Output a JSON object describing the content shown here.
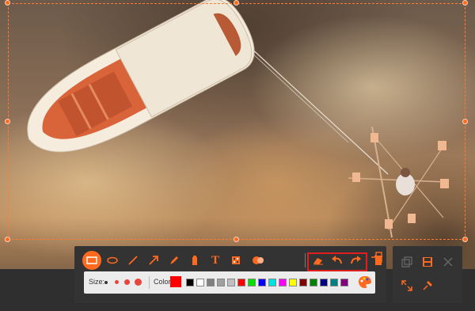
{
  "toolbar": {
    "tools": [
      {
        "name": "rectangle-tool",
        "icon": "rectangle-icon",
        "active": true
      },
      {
        "name": "ellipse-tool",
        "icon": "ellipse-icon",
        "active": false
      },
      {
        "name": "line-tool",
        "icon": "line-icon",
        "active": false
      },
      {
        "name": "arrow-tool",
        "icon": "arrow-icon",
        "active": false
      },
      {
        "name": "pen-tool",
        "icon": "pen-icon",
        "active": false
      },
      {
        "name": "highlighter-tool",
        "icon": "highlighter-icon",
        "active": false
      },
      {
        "name": "text-tool",
        "icon": "text-icon",
        "active": false
      },
      {
        "name": "blur-tool",
        "icon": "blur-icon",
        "active": false
      },
      {
        "name": "callout-tool",
        "icon": "callout-icon",
        "active": false
      }
    ],
    "text_tool_glyph": "T",
    "history": [
      "eraser-icon",
      "undo-icon",
      "redo-icon"
    ],
    "delete": "trash-icon",
    "exit": "exit-icon",
    "accent": "#ff6a1f",
    "highlight_border": "#e02020"
  },
  "options": {
    "size_label": "Size:",
    "color_label": "Color:",
    "current_color": "#ff0000",
    "palette": [
      "#000000",
      "#ffffff",
      "#808080",
      "#a0a0a0",
      "#c0c0c0",
      "#ff0000",
      "#00e000",
      "#0000ff",
      "#00e0e0",
      "#ff00ff",
      "#ffff00",
      "#800000",
      "#008000",
      "#000080",
      "#008080",
      "#800080"
    ],
    "palette_icon": "palette-icon"
  },
  "side_panel": {
    "buttons": [
      "copy-icon",
      "save-icon",
      "close-icon",
      "fullscreen-icon",
      "pin-icon"
    ]
  }
}
